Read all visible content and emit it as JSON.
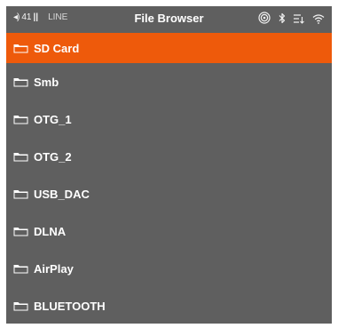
{
  "status": {
    "volume_value": "41",
    "line_label": "LINE",
    "title": "File Browser",
    "icons": [
      "target-icon",
      "bluetooth-icon",
      "playlist-icon",
      "wifi-icon"
    ]
  },
  "colors": {
    "background": "#5f5f5f",
    "accent": "#ee5a0b",
    "text": "#ffffff"
  },
  "items": [
    {
      "label": "SD Card",
      "selected": true
    },
    {
      "label": "Smb"
    },
    {
      "label": "OTG_1"
    },
    {
      "label": "OTG_2"
    },
    {
      "label": "USB_DAC"
    },
    {
      "label": "DLNA"
    },
    {
      "label": "AirPlay"
    },
    {
      "label": "BLUETOOTH"
    }
  ]
}
